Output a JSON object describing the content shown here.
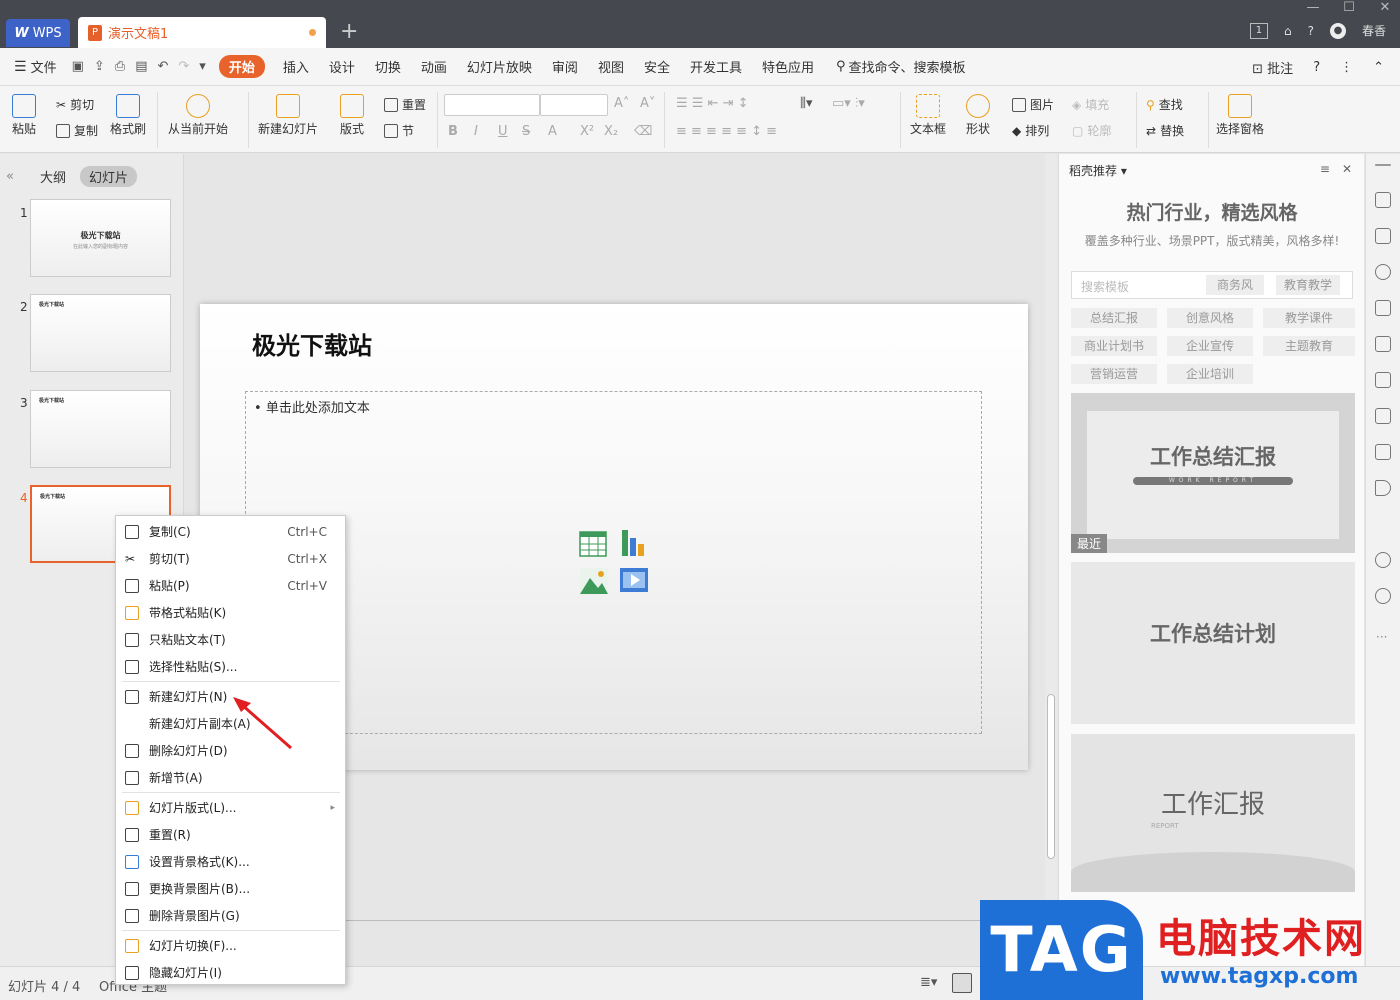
{
  "titlebar": {
    "wps_tab": "WPS",
    "doc_tab": "演示文稿1",
    "user": "春香"
  },
  "menubar": {
    "file": "文件",
    "tabs": [
      "开始",
      "插入",
      "设计",
      "切换",
      "动画",
      "幻灯片放映",
      "审阅",
      "视图",
      "安全",
      "开发工具",
      "特色应用"
    ],
    "search": "查找命令、搜索模板",
    "annotate": "批注"
  },
  "ribbon": {
    "paste": "粘贴",
    "cut": "剪切",
    "copy": "复制",
    "format_painter": "格式刷",
    "from_current": "从当前开始",
    "new_slide": "新建幻灯片",
    "layout": "版式",
    "reset": "重置",
    "section": "节",
    "textbox": "文本框",
    "shape": "形状",
    "picture": "图片",
    "fill": "填充",
    "arrange": "排列",
    "outline": "轮廓",
    "find": "查找",
    "replace": "替换",
    "select_pane": "选择窗格"
  },
  "left_panel": {
    "tab_outline": "大纲",
    "tab_slides": "幻灯片",
    "slides": [
      {
        "num": "1",
        "title": "极光下载站",
        "subtitle": "在此输入您的副标题内容"
      },
      {
        "num": "2",
        "title": "极光下载站"
      },
      {
        "num": "3",
        "title": "极光下载站"
      },
      {
        "num": "4",
        "title": "极光下载站"
      }
    ]
  },
  "slide": {
    "title": "极光下载站",
    "body_placeholder": "单击此处添加文本"
  },
  "context_menu": {
    "items": [
      {
        "label": "复制(C)",
        "shortcut": "Ctrl+C"
      },
      {
        "label": "剪切(T)",
        "shortcut": "Ctrl+X"
      },
      {
        "label": "粘贴(P)",
        "shortcut": "Ctrl+V"
      },
      {
        "label": "带格式粘贴(K)",
        "shortcut": ""
      },
      {
        "label": "只粘贴文本(T)",
        "shortcut": ""
      },
      {
        "label": "选择性粘贴(S)...",
        "shortcut": ""
      },
      {
        "label": "新建幻灯片(N)",
        "shortcut": ""
      },
      {
        "label": "新建幻灯片副本(A)",
        "shortcut": ""
      },
      {
        "label": "删除幻灯片(D)",
        "shortcut": ""
      },
      {
        "label": "新增节(A)",
        "shortcut": ""
      },
      {
        "label": "幻灯片版式(L)...",
        "shortcut": ""
      },
      {
        "label": "重置(R)",
        "shortcut": ""
      },
      {
        "label": "设置背景格式(K)...",
        "shortcut": ""
      },
      {
        "label": "更换背景图片(B)...",
        "shortcut": ""
      },
      {
        "label": "删除背景图片(G)",
        "shortcut": ""
      },
      {
        "label": "幻灯片切换(F)...",
        "shortcut": ""
      },
      {
        "label": "隐藏幻灯片(I)",
        "shortcut": ""
      }
    ]
  },
  "right_panel": {
    "header": "稻壳推荐",
    "headline": "热门行业，精选风格",
    "subline": "覆盖多种行业、场景PPT，版式精美，风格多样!",
    "search_placeholder": "搜索模板",
    "search_tags": [
      "商务风",
      "教育教学"
    ],
    "chips": [
      "总结汇报",
      "创意风格",
      "教学课件",
      "商业计划书",
      "企业宣传",
      "主题教育",
      "营销运营",
      "企业培训"
    ],
    "templates": [
      {
        "title": "工作总结汇报",
        "sub": "WORK REPORT",
        "badge": "最近"
      },
      {
        "title": "工作总结计划",
        "sub": ""
      },
      {
        "title": "工作汇报",
        "sub": "REPORT"
      }
    ]
  },
  "statusbar": {
    "slide_count": "幻灯片 4 / 4",
    "theme": "Office 主题"
  },
  "watermark": {
    "tag": "TAG",
    "site_name": "电脑技术网",
    "url": "www.tagxp.com"
  }
}
